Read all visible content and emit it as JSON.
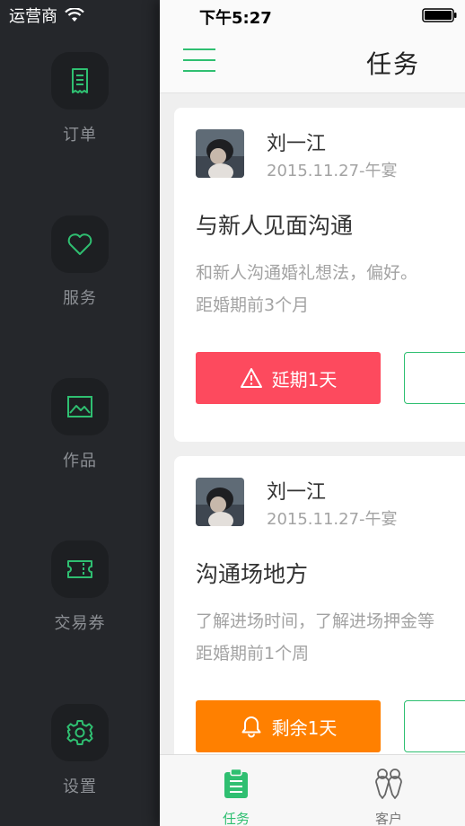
{
  "status_bar": {
    "carrier": "运营商",
    "time": "下午5:27"
  },
  "sidebar": {
    "items": [
      {
        "label": "订单",
        "icon": "receipt-icon"
      },
      {
        "label": "服务",
        "icon": "heart-icon"
      },
      {
        "label": "作品",
        "icon": "image-icon"
      },
      {
        "label": "交易券",
        "icon": "ticket-icon"
      },
      {
        "label": "设置",
        "icon": "gear-icon"
      }
    ]
  },
  "header": {
    "title": "任务",
    "menu_icon": "menu-icon"
  },
  "tasks": [
    {
      "author": "刘一江",
      "date": "2015.11.27-午宴",
      "title": "与新人见面沟通",
      "description": "和新人沟通婚礼想法，偏好。",
      "countdown": "距婚期前3个月",
      "status_label": "延期1天",
      "status_icon": "warning-icon",
      "status_color": "#fd4a5e"
    },
    {
      "author": "刘一江",
      "date": "2015.11.27-午宴",
      "title": "沟通场地方",
      "description": "了解进场时间，了解进场押金等",
      "countdown": "距婚期前1个周",
      "status_label": "剩余1天",
      "status_icon": "bell-icon",
      "status_color": "#ff8000"
    }
  ],
  "tab_bar": {
    "tabs": [
      {
        "label": "任务",
        "icon": "clipboard-icon",
        "active": true
      },
      {
        "label": "客户",
        "icon": "customers-icon",
        "active": false
      }
    ]
  },
  "colors": {
    "accent": "#2fbf71",
    "sidebar_bg": "#25272b",
    "overdue": "#fd4a5e",
    "remaining": "#ff8000"
  }
}
